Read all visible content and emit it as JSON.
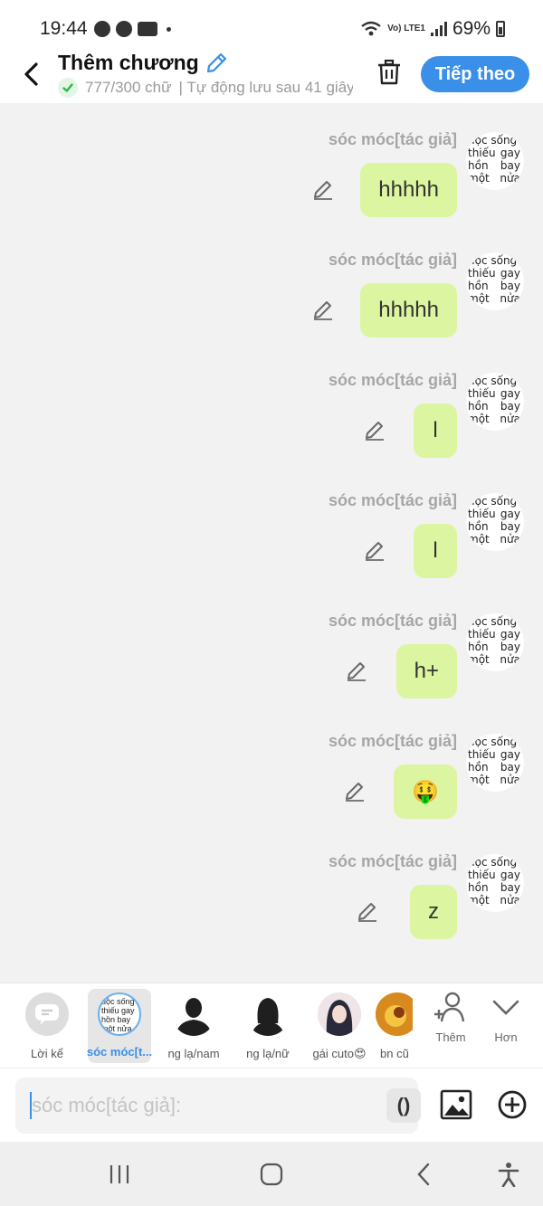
{
  "status_bar": {
    "time": "19:44",
    "network": "Vo) LTE1",
    "battery": "69%"
  },
  "header": {
    "title": "Thêm chương",
    "word_count": "777/300 chữ",
    "autosave": "| Tự động lưu sau 41 giây",
    "next_label": "Tiếp theo"
  },
  "messages": [
    {
      "author": "sóc móc[tác giả]",
      "text": "hhhhh"
    },
    {
      "author": "sóc móc[tác giả]",
      "text": "hhhhh"
    },
    {
      "author": "sóc móc[tác giả]",
      "text": "l"
    },
    {
      "author": "sóc móc[tác giả]",
      "text": "l"
    },
    {
      "author": "sóc móc[tác giả]",
      "text": "h+"
    },
    {
      "author": "sóc móc[tác giả]",
      "text": "🤑"
    },
    {
      "author": "sóc móc[tác giả]",
      "text": "z"
    }
  ],
  "avatar_text": {
    "line1": "uộc sống",
    "line2a": "thiếu",
    "line2b": "gay",
    "line3a": "hồn",
    "line3b": "bay",
    "line4a": "một",
    "line4b": "nửa"
  },
  "characters": [
    {
      "label": "Lời kể"
    },
    {
      "label": "sóc móc[t..."
    },
    {
      "label": "ng lạ/nam"
    },
    {
      "label": "ng lạ/nữ"
    },
    {
      "label": "gái cuto😍"
    },
    {
      "label": "bn cũ"
    }
  ],
  "more": {
    "add_label": "Thêm",
    "more_label": "Hơn"
  },
  "input": {
    "placeholder": "sóc móc[tác giả]:",
    "paren": "()"
  },
  "colors": {
    "accent": "#3a8fe8",
    "bubble": "#dcf5a0",
    "background": "#f2f2f2"
  }
}
